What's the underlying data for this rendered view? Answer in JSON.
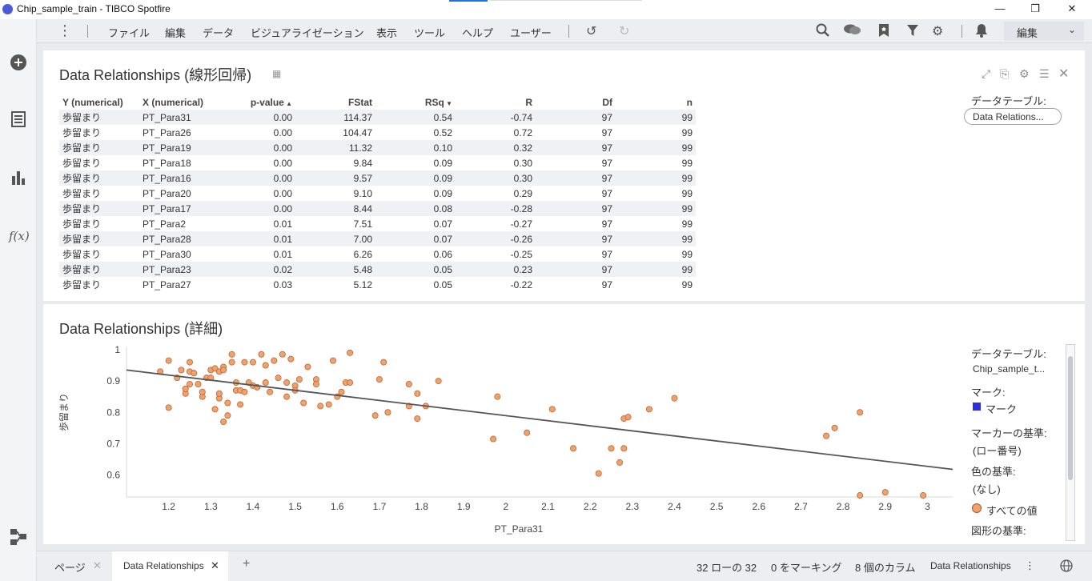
{
  "window": {
    "title": "Chip_sample_train - TIBCO Spotfire",
    "minimize": "—",
    "restore": "❐",
    "close": "✕"
  },
  "menu": {
    "items": [
      "ファイル",
      "編集",
      "データ",
      "ビジュアライゼーション",
      "表示",
      "ツール",
      "ヘルプ",
      "ユーザー"
    ],
    "user_select": "編集"
  },
  "relations_panel": {
    "title": "Data Relationships (線形回帰)",
    "columns": [
      "Y (numerical)",
      "X (numerical)",
      "p-value",
      "FStat",
      "RSq",
      "R",
      "Df",
      "n"
    ],
    "rows": [
      [
        "歩留まり",
        "PT_Para31",
        "0.00",
        "114.37",
        "0.54",
        "-0.74",
        "97",
        "99"
      ],
      [
        "歩留まり",
        "PT_Para26",
        "0.00",
        "104.47",
        "0.52",
        "0.72",
        "97",
        "99"
      ],
      [
        "歩留まり",
        "PT_Para19",
        "0.00",
        "11.32",
        "0.10",
        "0.32",
        "97",
        "99"
      ],
      [
        "歩留まり",
        "PT_Para18",
        "0.00",
        "9.84",
        "0.09",
        "0.30",
        "97",
        "99"
      ],
      [
        "歩留まり",
        "PT_Para16",
        "0.00",
        "9.57",
        "0.09",
        "0.30",
        "97",
        "99"
      ],
      [
        "歩留まり",
        "PT_Para20",
        "0.00",
        "9.10",
        "0.09",
        "0.29",
        "97",
        "99"
      ],
      [
        "歩留まり",
        "PT_Para17",
        "0.00",
        "8.44",
        "0.08",
        "-0.28",
        "97",
        "99"
      ],
      [
        "歩留まり",
        "PT_Para2",
        "0.01",
        "7.51",
        "0.07",
        "-0.27",
        "97",
        "99"
      ],
      [
        "歩留まり",
        "PT_Para28",
        "0.01",
        "7.00",
        "0.07",
        "-0.26",
        "97",
        "99"
      ],
      [
        "歩留まり",
        "PT_Para30",
        "0.01",
        "6.26",
        "0.06",
        "-0.25",
        "97",
        "99"
      ],
      [
        "歩留まり",
        "PT_Para23",
        "0.02",
        "5.48",
        "0.05",
        "0.23",
        "97",
        "99"
      ],
      [
        "歩留まり",
        "PT_Para27",
        "0.03",
        "5.12",
        "0.05",
        "-0.22",
        "97",
        "99"
      ]
    ],
    "data_table_label": "データテーブル:",
    "data_table_value": "Data Relations..."
  },
  "detail_panel": {
    "title": "Data Relationships (詳細)",
    "legend": {
      "data_table_label": "データテーブル:",
      "data_table_value": "Chip_sample_t...",
      "mark_label": "マーク:",
      "mark_value": "マーク",
      "mark_color": "#2c2ee0",
      "marker_basis_label": "マーカーの基準:",
      "marker_basis_value": "(ロー番号)",
      "color_basis_label": "色の基準:",
      "color_basis_value": "(なし)",
      "all_values_label": "すべての値",
      "point_color": "#f4a06a",
      "shape_basis_label": "図形の基準:"
    }
  },
  "chart_data": {
    "type": "scatter",
    "xlabel": "PT_Para31",
    "ylabel": "歩留まり",
    "xlim": [
      1.1,
      3.06
    ],
    "ylim": [
      0.53,
      1.01
    ],
    "xticks": [
      "1.2",
      "1.3",
      "1.4",
      "1.5",
      "1.6",
      "1.7",
      "1.8",
      "1.9",
      "2",
      "2.1",
      "2.2",
      "2.3",
      "2.4",
      "2.5",
      "2.6",
      "2.7",
      "2.8",
      "2.9",
      "3"
    ],
    "yticks": [
      "0.6",
      "0.7",
      "0.8",
      "0.9",
      "1"
    ],
    "regression_line": {
      "x": [
        1.1,
        3.06
      ],
      "y": [
        0.935,
        0.618
      ]
    },
    "points": [
      [
        1.18,
        0.93
      ],
      [
        1.2,
        0.965
      ],
      [
        1.2,
        0.815
      ],
      [
        1.22,
        0.91
      ],
      [
        1.23,
        0.935
      ],
      [
        1.24,
        0.86
      ],
      [
        1.24,
        0.875
      ],
      [
        1.25,
        0.89
      ],
      [
        1.25,
        0.96
      ],
      [
        1.25,
        0.93
      ],
      [
        1.26,
        0.925
      ],
      [
        1.27,
        0.89
      ],
      [
        1.28,
        0.85
      ],
      [
        1.28,
        0.865
      ],
      [
        1.29,
        0.91
      ],
      [
        1.3,
        0.935
      ],
      [
        1.3,
        0.91
      ],
      [
        1.31,
        0.81
      ],
      [
        1.31,
        0.94
      ],
      [
        1.32,
        0.93
      ],
      [
        1.32,
        0.845
      ],
      [
        1.32,
        0.86
      ],
      [
        1.33,
        0.945
      ],
      [
        1.33,
        0.935
      ],
      [
        1.33,
        0.77
      ],
      [
        1.34,
        0.79
      ],
      [
        1.34,
        0.83
      ],
      [
        1.35,
        0.985
      ],
      [
        1.35,
        0.96
      ],
      [
        1.36,
        0.895
      ],
      [
        1.36,
        0.87
      ],
      [
        1.37,
        0.825
      ],
      [
        1.37,
        0.87
      ],
      [
        1.38,
        0.96
      ],
      [
        1.38,
        0.865
      ],
      [
        1.39,
        0.895
      ],
      [
        1.4,
        0.96
      ],
      [
        1.4,
        0.885
      ],
      [
        1.41,
        0.88
      ],
      [
        1.42,
        0.985
      ],
      [
        1.43,
        0.95
      ],
      [
        1.43,
        0.895
      ],
      [
        1.44,
        0.865
      ],
      [
        1.45,
        0.965
      ],
      [
        1.46,
        0.91
      ],
      [
        1.47,
        0.985
      ],
      [
        1.48,
        0.85
      ],
      [
        1.48,
        0.895
      ],
      [
        1.49,
        0.97
      ],
      [
        1.5,
        0.885
      ],
      [
        1.5,
        0.87
      ],
      [
        1.51,
        0.905
      ],
      [
        1.52,
        0.83
      ],
      [
        1.53,
        0.945
      ],
      [
        1.55,
        0.905
      ],
      [
        1.55,
        0.89
      ],
      [
        1.56,
        0.82
      ],
      [
        1.58,
        0.825
      ],
      [
        1.59,
        0.965
      ],
      [
        1.6,
        0.85
      ],
      [
        1.61,
        0.865
      ],
      [
        1.62,
        0.895
      ],
      [
        1.63,
        0.895
      ],
      [
        1.63,
        0.99
      ],
      [
        1.69,
        0.79
      ],
      [
        1.7,
        0.905
      ],
      [
        1.71,
        0.96
      ],
      [
        1.72,
        0.8
      ],
      [
        1.77,
        0.89
      ],
      [
        1.77,
        0.82
      ],
      [
        1.79,
        0.86
      ],
      [
        1.79,
        0.78
      ],
      [
        1.81,
        0.82
      ],
      [
        1.84,
        0.9
      ],
      [
        1.97,
        0.715
      ],
      [
        1.98,
        0.85
      ],
      [
        2.05,
        0.735
      ],
      [
        2.11,
        0.81
      ],
      [
        2.16,
        0.685
      ],
      [
        2.22,
        0.605
      ],
      [
        2.25,
        0.685
      ],
      [
        2.27,
        0.64
      ],
      [
        2.28,
        0.685
      ],
      [
        2.28,
        0.78
      ],
      [
        2.29,
        0.785
      ],
      [
        2.34,
        0.81
      ],
      [
        2.4,
        0.845
      ],
      [
        2.76,
        0.725
      ],
      [
        2.78,
        0.75
      ],
      [
        2.84,
        0.8
      ],
      [
        2.84,
        0.535
      ],
      [
        2.9,
        0.545
      ],
      [
        2.99,
        0.535
      ]
    ]
  },
  "status": {
    "page_tab": "ページ",
    "active_tab": "Data Relationships",
    "add_tab": "+",
    "rows": "32 ローの 32",
    "marking": "0 をマーキング",
    "columns": "8 個のカラム",
    "table": "Data Relationships"
  }
}
